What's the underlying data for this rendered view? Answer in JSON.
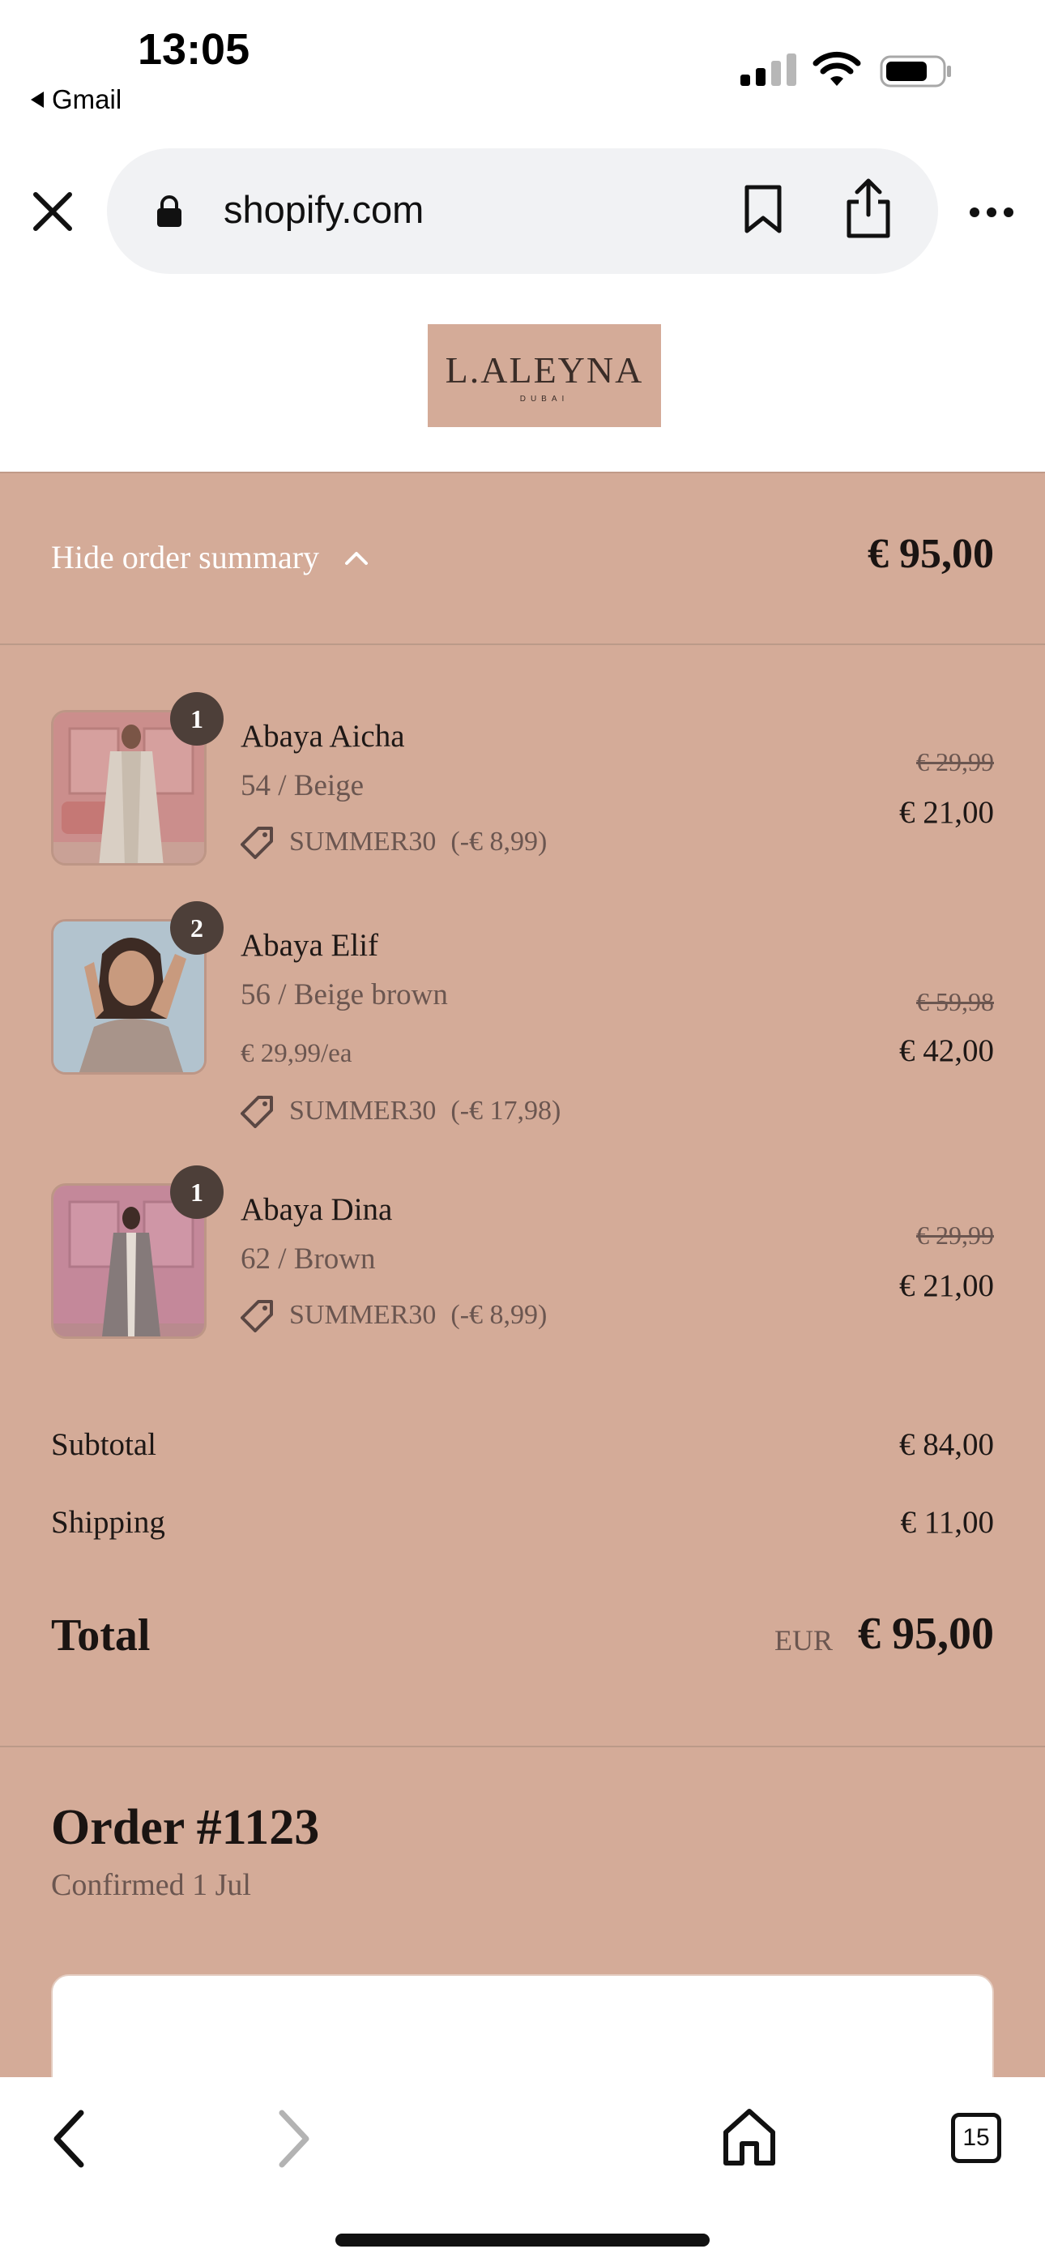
{
  "status_bar": {
    "time": "13:05",
    "back_app": "Gmail"
  },
  "browser": {
    "url": "shopify.com",
    "tabs_count": "15"
  },
  "brand": {
    "name": "L.ALEYNA",
    "sub": "DUBAI"
  },
  "summary": {
    "toggle_label": "Hide order summary",
    "header_total": "€ 95,00",
    "items": [
      {
        "qty": "1",
        "name": "Abaya Aicha",
        "variant": "54 / Beige",
        "discount_code": "SUMMER30",
        "discount_amount": "(-€ 8,99)",
        "original_price": "€ 29,99",
        "price": "€ 21,00"
      },
      {
        "qty": "2",
        "name": "Abaya Elif",
        "variant": "56 / Beige brown",
        "unit_price": "€ 29,99/ea",
        "discount_code": "SUMMER30",
        "discount_amount": "(-€ 17,98)",
        "original_price": "€ 59,98",
        "price": "€ 42,00"
      },
      {
        "qty": "1",
        "name": "Abaya Dina",
        "variant": "62 / Brown",
        "discount_code": "SUMMER30",
        "discount_amount": "(-€ 8,99)",
        "original_price": "€ 29,99",
        "price": "€ 21,00"
      }
    ],
    "subtotal_label": "Subtotal",
    "subtotal_value": "€ 84,00",
    "shipping_label": "Shipping",
    "shipping_value": "€ 11,00",
    "total_label": "Total",
    "total_currency": "EUR",
    "total_value": "€ 95,00"
  },
  "order": {
    "title": "Order #1123",
    "confirmed": "Confirmed 1 Jul"
  },
  "colors": {
    "accent": "#d4ab98",
    "badge": "#4d3f39"
  }
}
